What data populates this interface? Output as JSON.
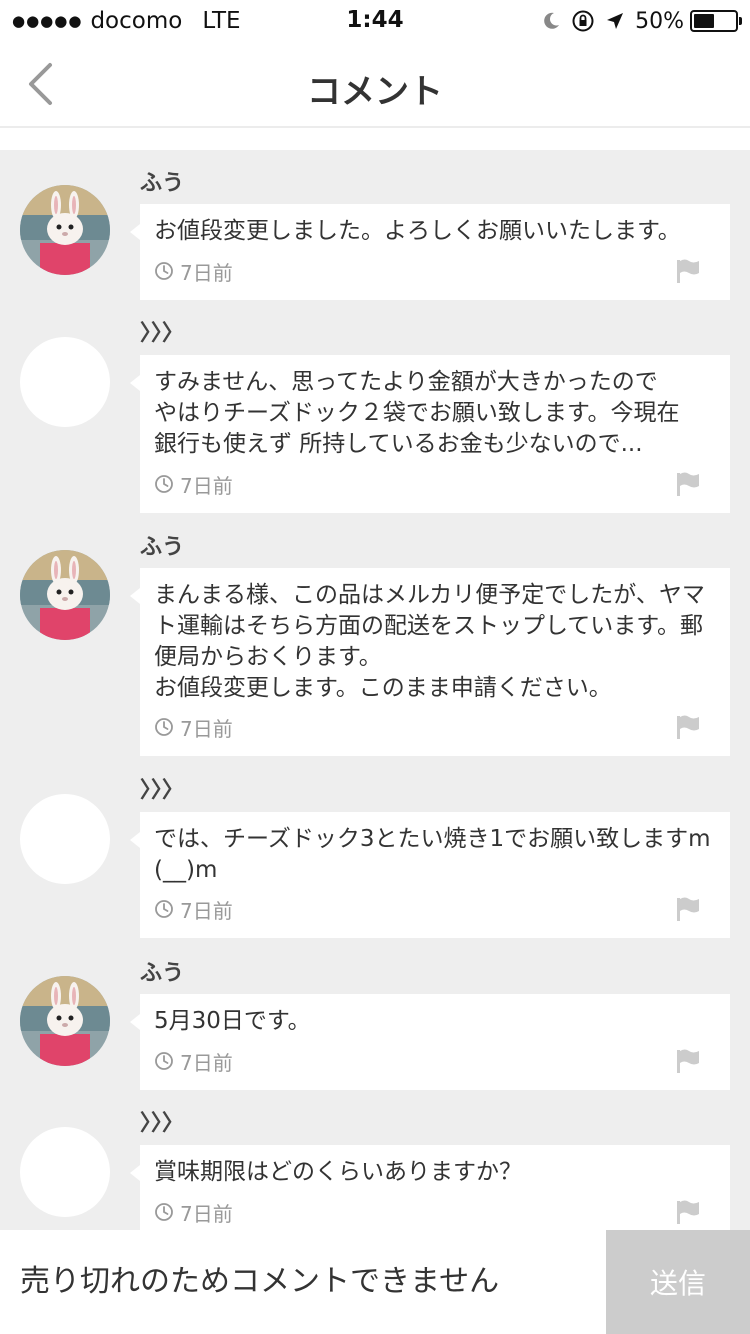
{
  "status_bar": {
    "signal": "●●●●●",
    "carrier": "docomo",
    "network": "LTE",
    "time": "1:44",
    "battery": "50%",
    "battery_level": 0.5
  },
  "header": {
    "title": "コメント"
  },
  "comments": [
    {
      "user": "ふう",
      "text": "お値段変更しました。よろしくお願いいたします。",
      "time": "7日前",
      "avatar": "bunny-photo"
    },
    {
      "user": "〉〉〉",
      "text": "すみません、思ってたより金額が大きかったので\nやはりチーズドック２袋でお願い致します。今現在\n銀行も使えず 所持しているお金も少ないので...",
      "time": "7日前",
      "avatar": "blank"
    },
    {
      "user": "ふう",
      "text": "まんまる様、この品はメルカリ便予定でしたが、ヤマト運輸はそちら方面の配送をストップしています。郵便局からおくります。\nお値段変更します。このまま申請ください。",
      "time": "7日前",
      "avatar": "bunny-photo"
    },
    {
      "user": "〉〉〉",
      "text": "では、チーズドック3とたい焼き1でお願い致しますm(__)m",
      "time": "7日前",
      "avatar": "blank"
    },
    {
      "user": "ふう",
      "text": "5月30日です。",
      "time": "7日前",
      "avatar": "bunny-photo"
    },
    {
      "user": "〉〉〉",
      "text": "賞味期限はどのくらいありますか？",
      "time": "7日前",
      "avatar": "blank"
    }
  ],
  "footer": {
    "input_placeholder": "売り切れのためコメントできません",
    "send_label": "送信"
  },
  "colors": {
    "list_background": "#eeeeee",
    "send_button": "#cccccc",
    "meta_text": "#999999"
  }
}
